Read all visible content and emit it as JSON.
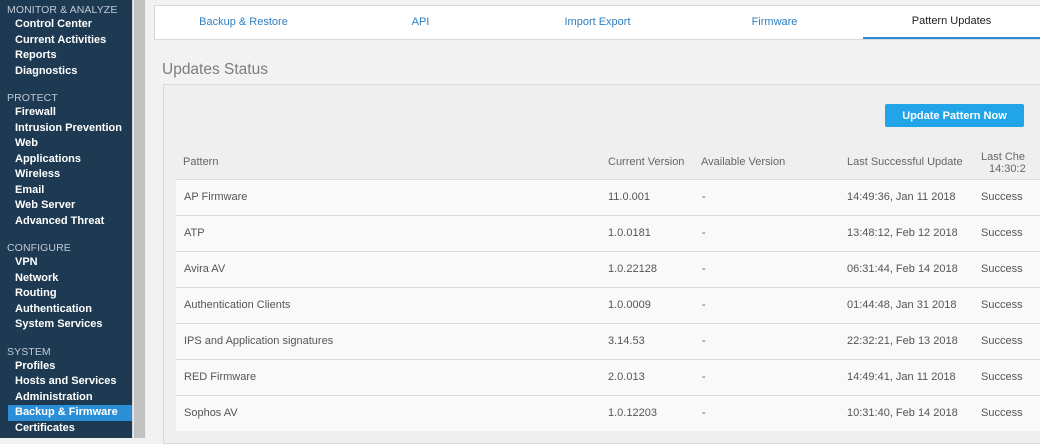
{
  "sidebar": {
    "sections": [
      {
        "title": "MONITOR & ANALYZE",
        "items": [
          "Control Center",
          "Current Activities",
          "Reports",
          "Diagnostics"
        ]
      },
      {
        "title": "PROTECT",
        "items": [
          "Firewall",
          "Intrusion Prevention",
          "Web",
          "Applications",
          "Wireless",
          "Email",
          "Web Server",
          "Advanced Threat"
        ]
      },
      {
        "title": "CONFIGURE",
        "items": [
          "VPN",
          "Network",
          "Routing",
          "Authentication",
          "System Services"
        ]
      },
      {
        "title": "SYSTEM",
        "items": [
          "Profiles",
          "Hosts and Services",
          "Administration",
          "Backup & Firmware",
          "Certificates"
        ]
      }
    ],
    "active_item": "Backup & Firmware"
  },
  "tabs": [
    "Backup & Restore",
    "API",
    "Import Export",
    "Firmware",
    "Pattern Updates"
  ],
  "active_tab": "Pattern Updates",
  "section_title": "Updates Status",
  "update_button_label": "Update Pattern Now",
  "table": {
    "headers": {
      "pattern": "Pattern",
      "current_version": "Current Version",
      "available_version": "Available Version",
      "last_successful_update": "Last Successful Update",
      "last_check_line1": "Last Che",
      "last_check_line2": "14:30:2"
    },
    "rows": [
      {
        "pattern": "AP Firmware",
        "current": "11.0.001",
        "available": "-",
        "last_update": "14:49:36, Jan 11 2018",
        "status": "Success"
      },
      {
        "pattern": "ATP",
        "current": "1.0.0181",
        "available": "-",
        "last_update": "13:48:12, Feb 12 2018",
        "status": "Success"
      },
      {
        "pattern": "Avira AV",
        "current": "1.0.22128",
        "available": "-",
        "last_update": "06:31:44, Feb 14 2018",
        "status": "Success"
      },
      {
        "pattern": "Authentication Clients",
        "current": "1.0.0009",
        "available": "-",
        "last_update": "01:44:48, Jan 31 2018",
        "status": "Success"
      },
      {
        "pattern": "IPS and Application signatures",
        "current": "3.14.53",
        "available": "-",
        "last_update": "22:32:21, Feb 13 2018",
        "status": "Success"
      },
      {
        "pattern": "RED Firmware",
        "current": "2.0.013",
        "available": "-",
        "last_update": "14:49:41, Jan 11 2018",
        "status": "Success"
      },
      {
        "pattern": "Sophos AV",
        "current": "1.0.12203",
        "available": "-",
        "last_update": "10:31:40, Feb 14 2018",
        "status": "Success"
      }
    ]
  },
  "colors": {
    "sidebar_bg": "#1d3a52",
    "accent": "#2a8fd6",
    "button": "#22a4e9",
    "tab_text": "#2d7fc1"
  }
}
